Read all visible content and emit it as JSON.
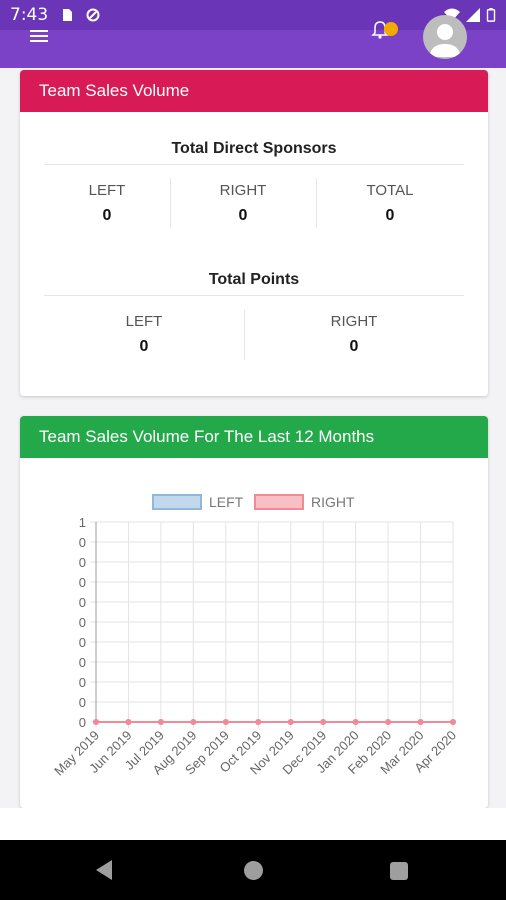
{
  "status_bar": {
    "time": "7:43"
  },
  "card1": {
    "title": "Team Sales Volume",
    "header_color": "#d81b56",
    "direct_sponsors": {
      "title": "Total Direct Sponsors",
      "left_label": "LEFT",
      "left_value": "0",
      "right_label": "RIGHT",
      "right_value": "0",
      "total_label": "TOTAL",
      "total_value": "0"
    },
    "points": {
      "title": "Total Points",
      "left_label": "LEFT",
      "left_value": "0",
      "right_label": "RIGHT",
      "right_value": "0"
    }
  },
  "card2": {
    "title": "Team Sales Volume For The Last 12 Months",
    "header_color": "#23a94a"
  },
  "chart_data": {
    "type": "line",
    "categories": [
      "May 2019",
      "Jun 2019",
      "Jul 2019",
      "Aug 2019",
      "Sep 2019",
      "Oct 2019",
      "Nov 2019",
      "Dec 2019",
      "Jan 2020",
      "Feb 2020",
      "Mar 2020",
      "Apr 2020"
    ],
    "series": [
      {
        "name": "LEFT",
        "values": [
          0,
          0,
          0,
          0,
          0,
          0,
          0,
          0,
          0,
          0,
          0,
          0
        ],
        "color": "#8fb8dd"
      },
      {
        "name": "RIGHT",
        "values": [
          0,
          0,
          0,
          0,
          0,
          0,
          0,
          0,
          0,
          0,
          0,
          0
        ],
        "color": "#f28a96"
      }
    ],
    "y_tick_labels": [
      "1",
      "0",
      "0",
      "0",
      "0",
      "0",
      "0",
      "0",
      "0",
      "0",
      "0"
    ],
    "ylim": [
      0,
      1
    ],
    "grid": true,
    "legend": "top-center"
  }
}
